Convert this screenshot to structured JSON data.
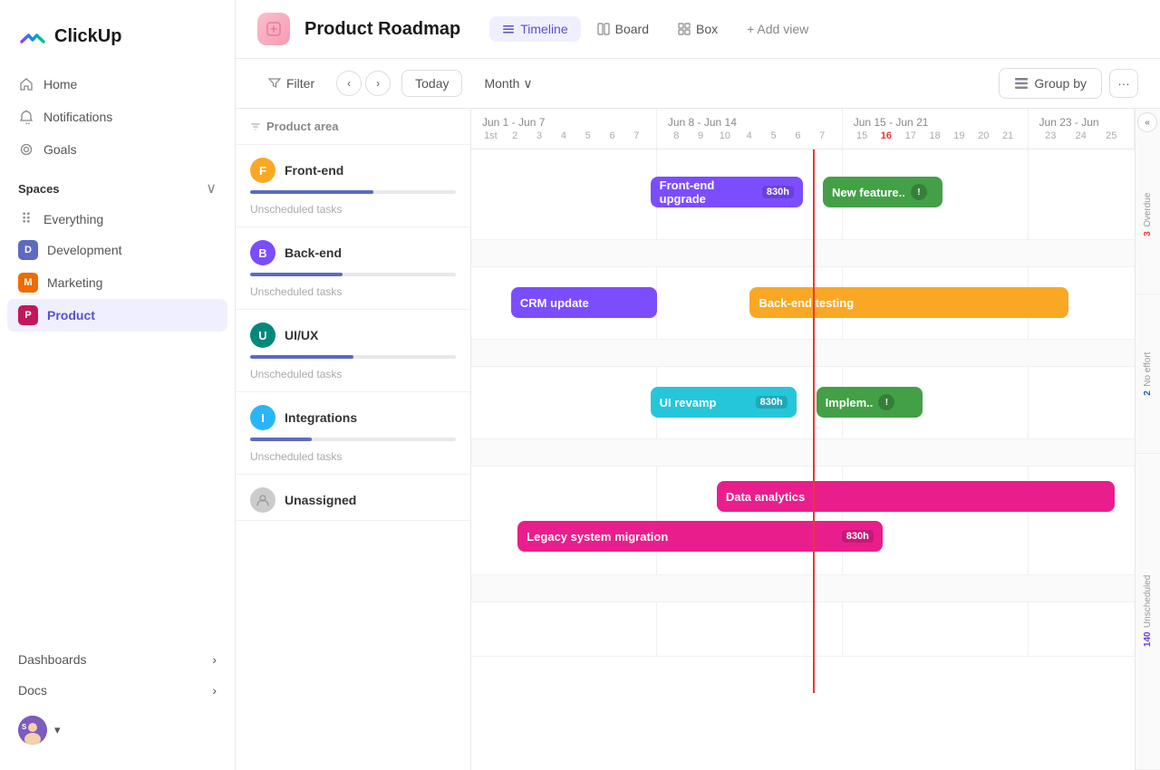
{
  "sidebar": {
    "logo_text": "ClickUp",
    "nav": [
      {
        "id": "home",
        "label": "Home",
        "icon": "🏠"
      },
      {
        "id": "notifications",
        "label": "Notifications",
        "icon": "🔔"
      },
      {
        "id": "goals",
        "label": "Goals",
        "icon": "🎯"
      }
    ],
    "spaces_label": "Spaces",
    "spaces": [
      {
        "id": "everything",
        "label": "Everything",
        "icon": "⠿",
        "color": ""
      },
      {
        "id": "development",
        "label": "Development",
        "abbr": "D",
        "color": "#5c6bc0"
      },
      {
        "id": "marketing",
        "label": "Marketing",
        "abbr": "M",
        "color": "#ef6c00"
      },
      {
        "id": "product",
        "label": "Product",
        "abbr": "P",
        "color": "#c2185b",
        "active": true
      }
    ],
    "sections": [
      {
        "id": "dashboards",
        "label": "Dashboards",
        "has_arrow": true
      },
      {
        "id": "docs",
        "label": "Docs",
        "has_arrow": true
      }
    ],
    "user": {
      "initials": "S",
      "color": "#6c3be4"
    }
  },
  "header": {
    "project_icon_color": "#f89ab0",
    "title": "Product Roadmap",
    "views": [
      {
        "id": "timeline",
        "label": "Timeline",
        "active": true,
        "icon": "≡"
      },
      {
        "id": "board",
        "label": "Board",
        "active": false,
        "icon": "▦"
      },
      {
        "id": "box",
        "label": "Box",
        "active": false,
        "icon": "⊞"
      }
    ],
    "add_view_label": "+ Add view"
  },
  "toolbar": {
    "filter_label": "Filter",
    "today_label": "Today",
    "month_label": "Month",
    "group_by_label": "Group by"
  },
  "timeline": {
    "column_header": "Product area",
    "weeks": [
      {
        "label": "Jun 1 - Jun 7",
        "days": [
          "1st",
          "2",
          "3",
          "4",
          "5",
          "6",
          "7"
        ]
      },
      {
        "label": "Jun 8 - Jun 14",
        "days": [
          "8",
          "9",
          "10",
          "4",
          "5",
          "6",
          "7"
        ]
      },
      {
        "label": "Jun 15 - Jun 21",
        "days": [
          "15",
          "16",
          "17",
          "18",
          "19",
          "20",
          "21"
        ]
      },
      {
        "label": "Jun 23 - Jun",
        "days": [
          "23",
          "24",
          "25"
        ]
      }
    ],
    "today_day": 16,
    "groups": [
      {
        "id": "frontend",
        "name": "Front-end",
        "abbr": "F",
        "color": "#f9a825",
        "progress": 60,
        "progress_color": "#5c6bc0",
        "tasks": [
          {
            "label": "Front-end upgrade",
            "time": "830h",
            "color": "#7c4dff",
            "start_pct": 28,
            "width_pct": 24
          },
          {
            "label": "New feature..",
            "time": "",
            "color": "#43a047",
            "start_pct": 55,
            "width_pct": 18,
            "warning": true
          }
        ]
      },
      {
        "id": "backend",
        "name": "Back-end",
        "abbr": "B",
        "color": "#7c4dff",
        "progress": 45,
        "progress_color": "#5c6bc0",
        "tasks": [
          {
            "label": "CRM update",
            "time": "",
            "color": "#7c4dff",
            "start_pct": 8,
            "width_pct": 22
          },
          {
            "label": "Back-end testing",
            "time": "",
            "color": "#f9a825",
            "start_pct": 43,
            "width_pct": 42
          }
        ]
      },
      {
        "id": "uiux",
        "name": "UI/UX",
        "abbr": "U",
        "color": "#00897b",
        "progress": 50,
        "progress_color": "#5c6bc0",
        "tasks": [
          {
            "label": "UI revamp",
            "time": "830h",
            "color": "#26c6da",
            "start_pct": 28,
            "width_pct": 24
          },
          {
            "label": "Implem..",
            "time": "",
            "color": "#43a047",
            "start_pct": 55,
            "width_pct": 16,
            "warning": true
          }
        ]
      },
      {
        "id": "integrations",
        "name": "Integrations",
        "abbr": "I",
        "color": "#29b6f6",
        "progress": 30,
        "progress_color": "#5c6bc0",
        "tasks": [
          {
            "label": "Data analytics",
            "time": "",
            "color": "#e91e8c",
            "start_pct": 38,
            "width_pct": 58
          },
          {
            "label": "Legacy system migration",
            "time": "830h",
            "color": "#e91e8c",
            "start_pct": 8,
            "width_pct": 55
          }
        ]
      },
      {
        "id": "unassigned",
        "name": "Unassigned",
        "abbr": "",
        "color": "#ccc",
        "progress": 0,
        "tasks": []
      }
    ]
  },
  "right_sidebar": [
    {
      "count": "3",
      "label": "Overdue",
      "color_class": "red"
    },
    {
      "count": "2",
      "label": "No effort",
      "color_class": "blue"
    },
    {
      "count": "140",
      "label": "Unscheduled",
      "color_class": "purple"
    }
  ]
}
